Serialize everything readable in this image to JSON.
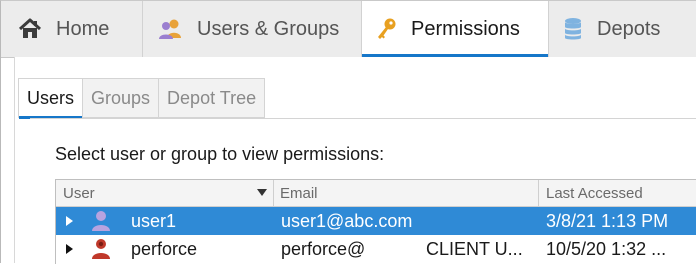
{
  "top_tabs": [
    {
      "label": "Home",
      "icon": "home-icon"
    },
    {
      "label": "Users & Groups",
      "icon": "users-icon"
    },
    {
      "label": "Permissions",
      "icon": "key-icon"
    },
    {
      "label": "Depots",
      "icon": "database-icon"
    }
  ],
  "active_top_tab": "Permissions",
  "sub_tabs": [
    {
      "label": "Users"
    },
    {
      "label": "Groups"
    },
    {
      "label": "Depot Tree"
    }
  ],
  "active_sub_tab": "Users",
  "prompt": "Select user or group to view permissions:",
  "table": {
    "columns": [
      "User",
      "Email",
      "Last Accessed"
    ],
    "rows": [
      {
        "user": "user1",
        "email": "user1@abc.com",
        "type": "",
        "last_accessed": "3/8/21 1:13 PM",
        "selected": true
      },
      {
        "user": "perforce",
        "email": "perforce@",
        "type": "CLIENT U...",
        "last_accessed": "10/5/20 1:32 ...",
        "selected": false
      }
    ]
  },
  "colors": {
    "accent": "#1677c9",
    "selected_row": "#2f8ad6",
    "users_icon": "#e8a23a",
    "key_icon": "#e8a020",
    "depot_icon": "#7fb3e0",
    "avatar_user1": "#b7a3e0",
    "avatar_perforce": "#c0392b"
  }
}
